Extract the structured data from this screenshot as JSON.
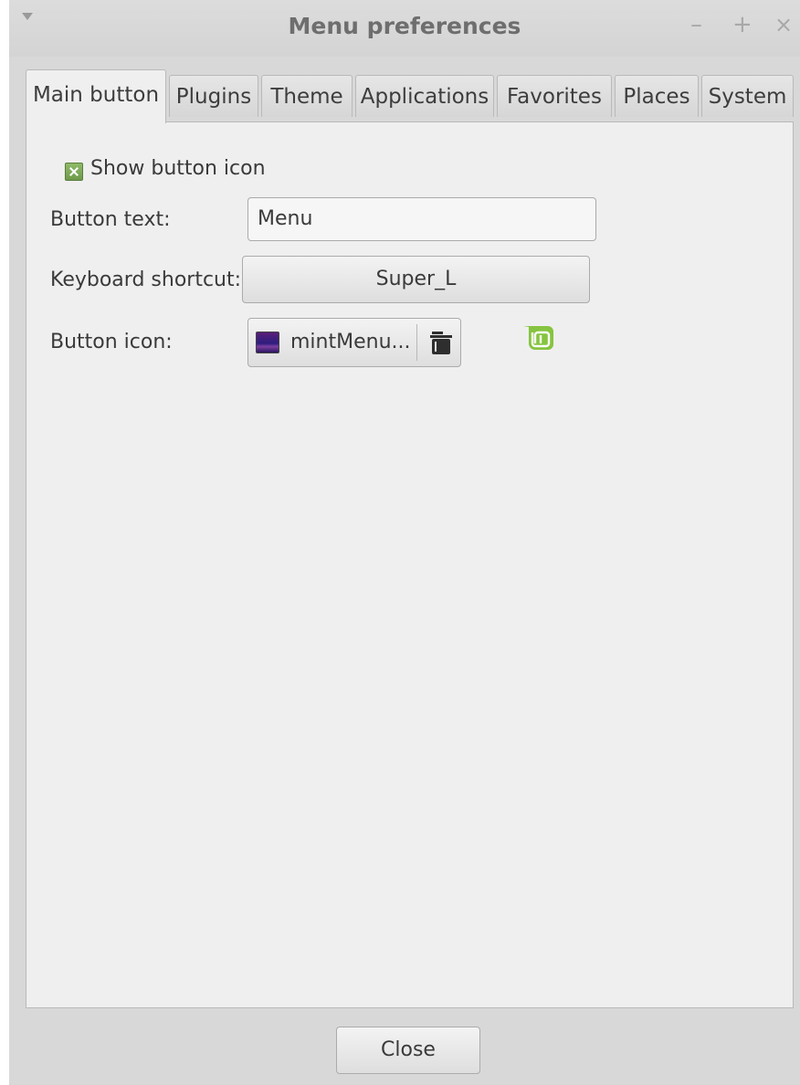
{
  "window": {
    "title": "Menu preferences",
    "controls": {
      "minimize": "–",
      "maximize": "+",
      "close": "×"
    }
  },
  "tabs": [
    {
      "label": "Main button",
      "active": true
    },
    {
      "label": "Plugins",
      "active": false
    },
    {
      "label": "Theme",
      "active": false
    },
    {
      "label": "Applications",
      "active": false
    },
    {
      "label": "Favorites",
      "active": false
    },
    {
      "label": "Places",
      "active": false
    },
    {
      "label": "System",
      "active": false
    }
  ],
  "main_button": {
    "show_icon": {
      "label": "Show button icon",
      "checked": true
    },
    "button_text": {
      "label": "Button text:",
      "value": "Menu"
    },
    "keyboard_shortcut": {
      "label": "Keyboard shortcut:",
      "value": "Super_L"
    },
    "button_icon": {
      "label": "Button icon:",
      "file": "mintMenu..."
    }
  },
  "footer": {
    "close_label": "Close"
  },
  "colors": {
    "mint_green": "#86c440",
    "checkbox_green": "#7aa656",
    "panel_bg": "#efefef",
    "window_bg": "#d8d8d8"
  },
  "icons": [
    "window-menu-icon",
    "folder-icon",
    "image-thumbnail-icon",
    "mint-logo-icon",
    "checkbox-checked-icon"
  ]
}
